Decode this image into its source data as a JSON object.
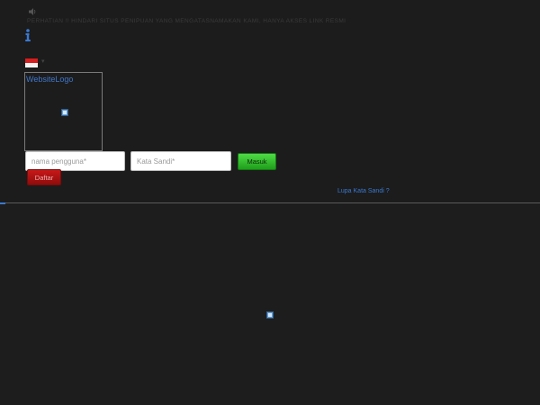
{
  "header": {
    "speaker_icon": "speaker-icon",
    "marquee_text": "PERHATIAN !! HINDARI SITUS PENIPUAN YANG MENGATASNAMAKAN KAMI, HANYA AKSES LINK RESMI",
    "info_icon": "info-icon"
  },
  "language": {
    "label": "",
    "flag": "indonesia-flag",
    "caret": "▾"
  },
  "logo": {
    "alt_text": "WebsiteLogo"
  },
  "login_form": {
    "username_placeholder": "nama pengguna*",
    "password_placeholder": "Kata Sandi*",
    "login_label": "Masuk",
    "register_label": "Daftar",
    "forgot_label": "Lupa Kata Sandi ?"
  },
  "colors": {
    "background": "#1c1c1c",
    "login_green": "#2fbf28",
    "register_red": "#b01414",
    "link_blue": "#3a79d1"
  }
}
